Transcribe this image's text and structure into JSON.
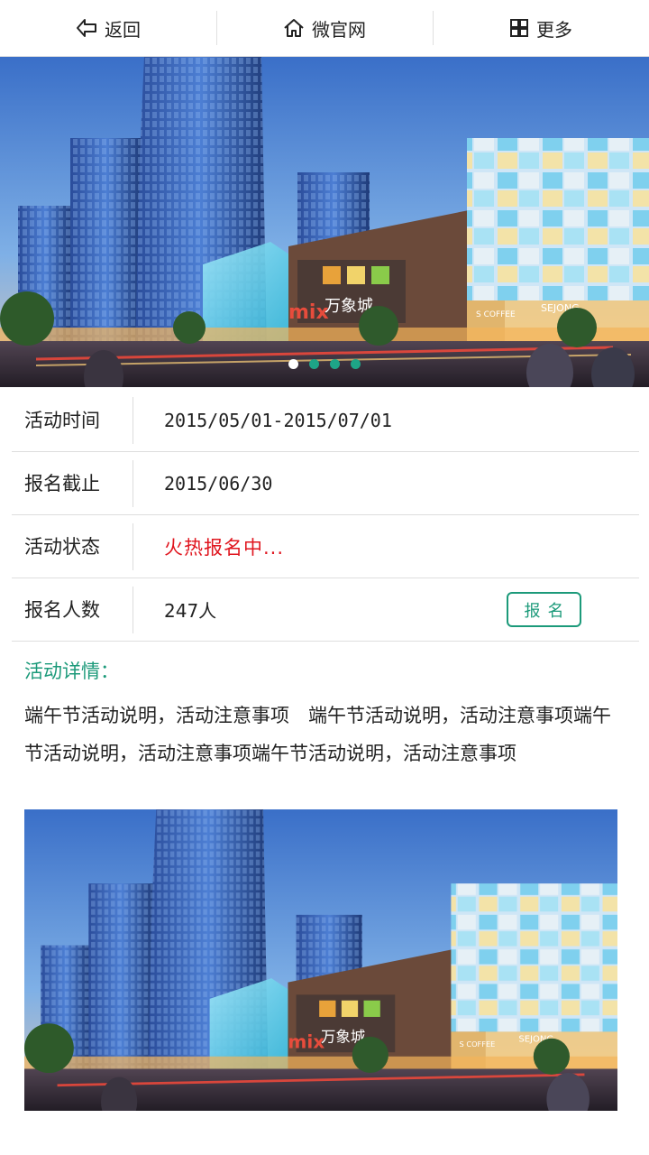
{
  "topbar": {
    "back_label": "返回",
    "site_label": "微官网",
    "more_label": "更多"
  },
  "banner": {
    "slides": 4,
    "active_slide": 1,
    "image_text": {
      "mall_logo": "mixc",
      "mall_name": "万象城",
      "shop_1": "SEJONG",
      "shop_2": "S COFFEE"
    }
  },
  "info": {
    "time_label": "活动时间",
    "time_value": "2015/05/01-2015/07/01",
    "deadline_label": "报名截止",
    "deadline_value": "2015/06/30",
    "status_label": "活动状态",
    "status_value": "火热报名中...",
    "count_label": "报名人数",
    "count_value": "247人",
    "signup_label": "报名"
  },
  "detail": {
    "title": "活动详情：",
    "text": "端午节活动说明，活动注意事项　端午节活动说明，活动注意事项端午节活动说明，活动注意事项端午节活动说明，活动注意事项"
  },
  "colors": {
    "accent": "#1c9a7a",
    "status": "#e0161f",
    "dot": "#1ea587"
  },
  "icons": {
    "back": "back-arrow-icon",
    "home": "home-icon",
    "more": "grid-icon"
  }
}
